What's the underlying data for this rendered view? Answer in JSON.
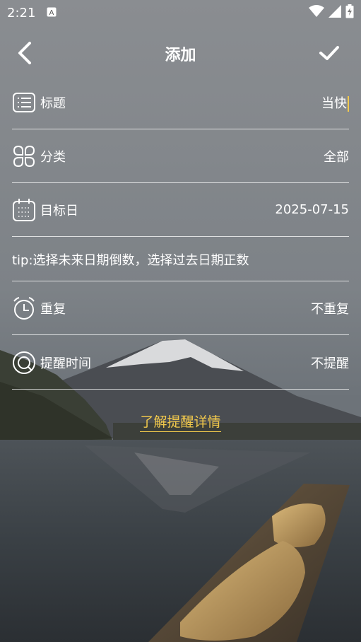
{
  "status_bar": {
    "time": "2:21",
    "notification_icon": "a-letter-icon"
  },
  "toolbar": {
    "title": "添加",
    "back_icon": "chevron-left-icon",
    "confirm_icon": "check-icon"
  },
  "form": {
    "title_row": {
      "label": "标题",
      "value": "当快"
    },
    "category_row": {
      "label": "分类",
      "value": "全部"
    },
    "date_row": {
      "label": "目标日",
      "value": "2025-07-15"
    },
    "tip": "tip:选择未来日期倒数，选择过去日期正数",
    "repeat_row": {
      "label": "重复",
      "value": "不重复"
    },
    "reminder_row": {
      "label": "提醒时间",
      "value": "不提醒"
    }
  },
  "link": {
    "label": "了解提醒详情"
  },
  "colors": {
    "accent": "#f2c94c",
    "text": "#ffffff"
  }
}
